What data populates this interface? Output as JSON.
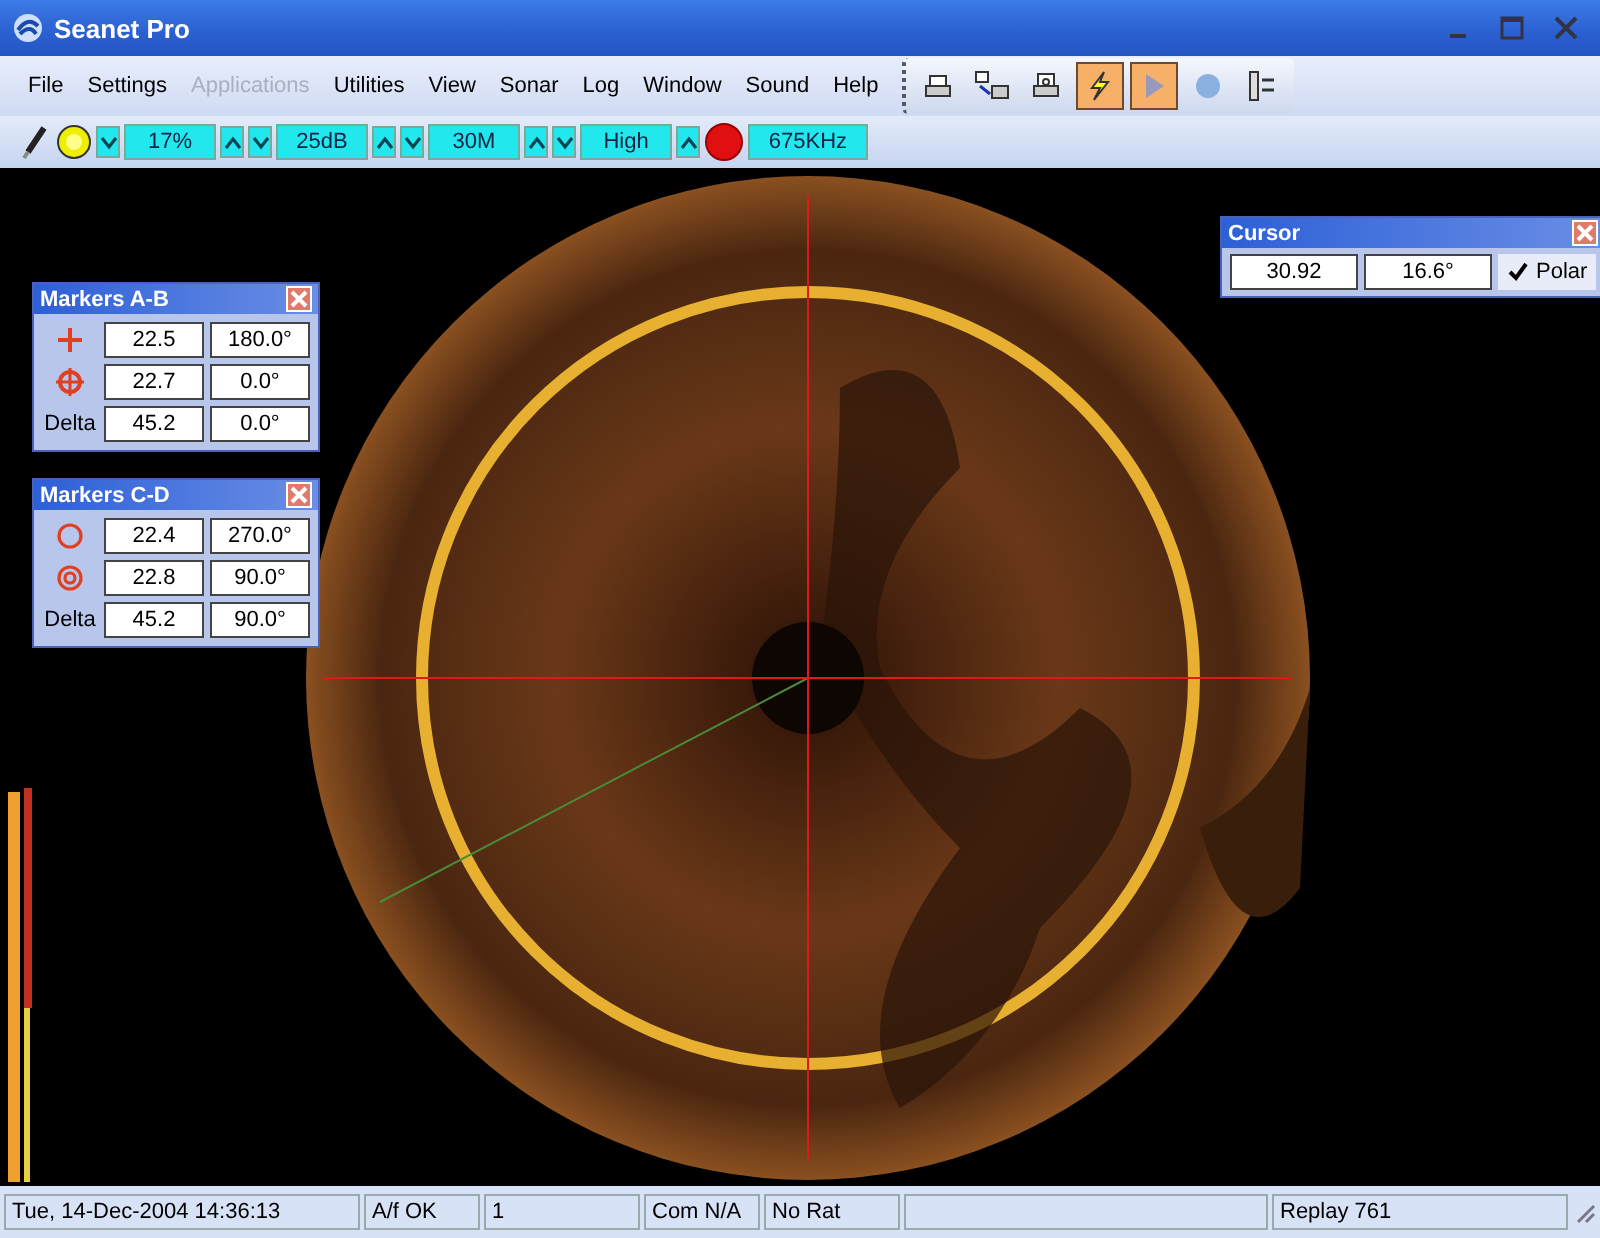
{
  "window": {
    "title": "Seanet Pro"
  },
  "menu": [
    {
      "label": "File",
      "disabled": false
    },
    {
      "label": "Settings",
      "disabled": false
    },
    {
      "label": "Applications",
      "disabled": true
    },
    {
      "label": "Utilities",
      "disabled": false
    },
    {
      "label": "View",
      "disabled": false
    },
    {
      "label": "Sonar",
      "disabled": false
    },
    {
      "label": "Log",
      "disabled": false
    },
    {
      "label": "Window",
      "disabled": false
    },
    {
      "label": "Sound",
      "disabled": false
    },
    {
      "label": "Help",
      "disabled": false
    }
  ],
  "toolbar_buttons": [
    {
      "kind": "printer",
      "selected": false
    },
    {
      "kind": "print-setup",
      "selected": false
    },
    {
      "kind": "print-preview",
      "selected": false
    },
    {
      "kind": "lightning",
      "selected": true
    },
    {
      "kind": "play",
      "selected": true
    },
    {
      "kind": "record",
      "selected": false
    },
    {
      "kind": "settings-list",
      "selected": false
    }
  ],
  "sonar_controls": [
    {
      "kind": "pen"
    },
    {
      "kind": "lamp"
    },
    {
      "kind": "spinner",
      "value": "17%"
    },
    {
      "kind": "spinner",
      "value": "25dB"
    },
    {
      "kind": "spinner",
      "value": "30M"
    },
    {
      "kind": "spinner",
      "value": "High"
    },
    {
      "kind": "transmit"
    },
    {
      "kind": "readout",
      "value": "675KHz"
    }
  ],
  "marker_panels": [
    {
      "title": "Markers A-B",
      "rows": [
        {
          "kind": "cross",
          "range": "22.5",
          "bearing": "180.0°"
        },
        {
          "kind": "target",
          "range": "22.7",
          "bearing": "0.0°"
        },
        {
          "kind": "label",
          "label": "Delta",
          "range": "45.2",
          "bearing": "0.0°"
        }
      ]
    },
    {
      "title": "Markers C-D",
      "rows": [
        {
          "kind": "ring",
          "range": "22.4",
          "bearing": "270.0°"
        },
        {
          "kind": "double-ring",
          "range": "22.8",
          "bearing": "90.0°"
        },
        {
          "kind": "label",
          "label": "Delta",
          "range": "45.2",
          "bearing": "90.0°"
        }
      ]
    }
  ],
  "cursor": {
    "title": "Cursor",
    "range": "30.92",
    "bearing": "16.6°",
    "polar": {
      "label": "Polar",
      "checked": true
    }
  },
  "status_bar": [
    "Tue, 14-Dec-2004 14:36:13",
    "A/f OK",
    "1",
    "Com N/A",
    "No Rat",
    "Replay 761"
  ]
}
